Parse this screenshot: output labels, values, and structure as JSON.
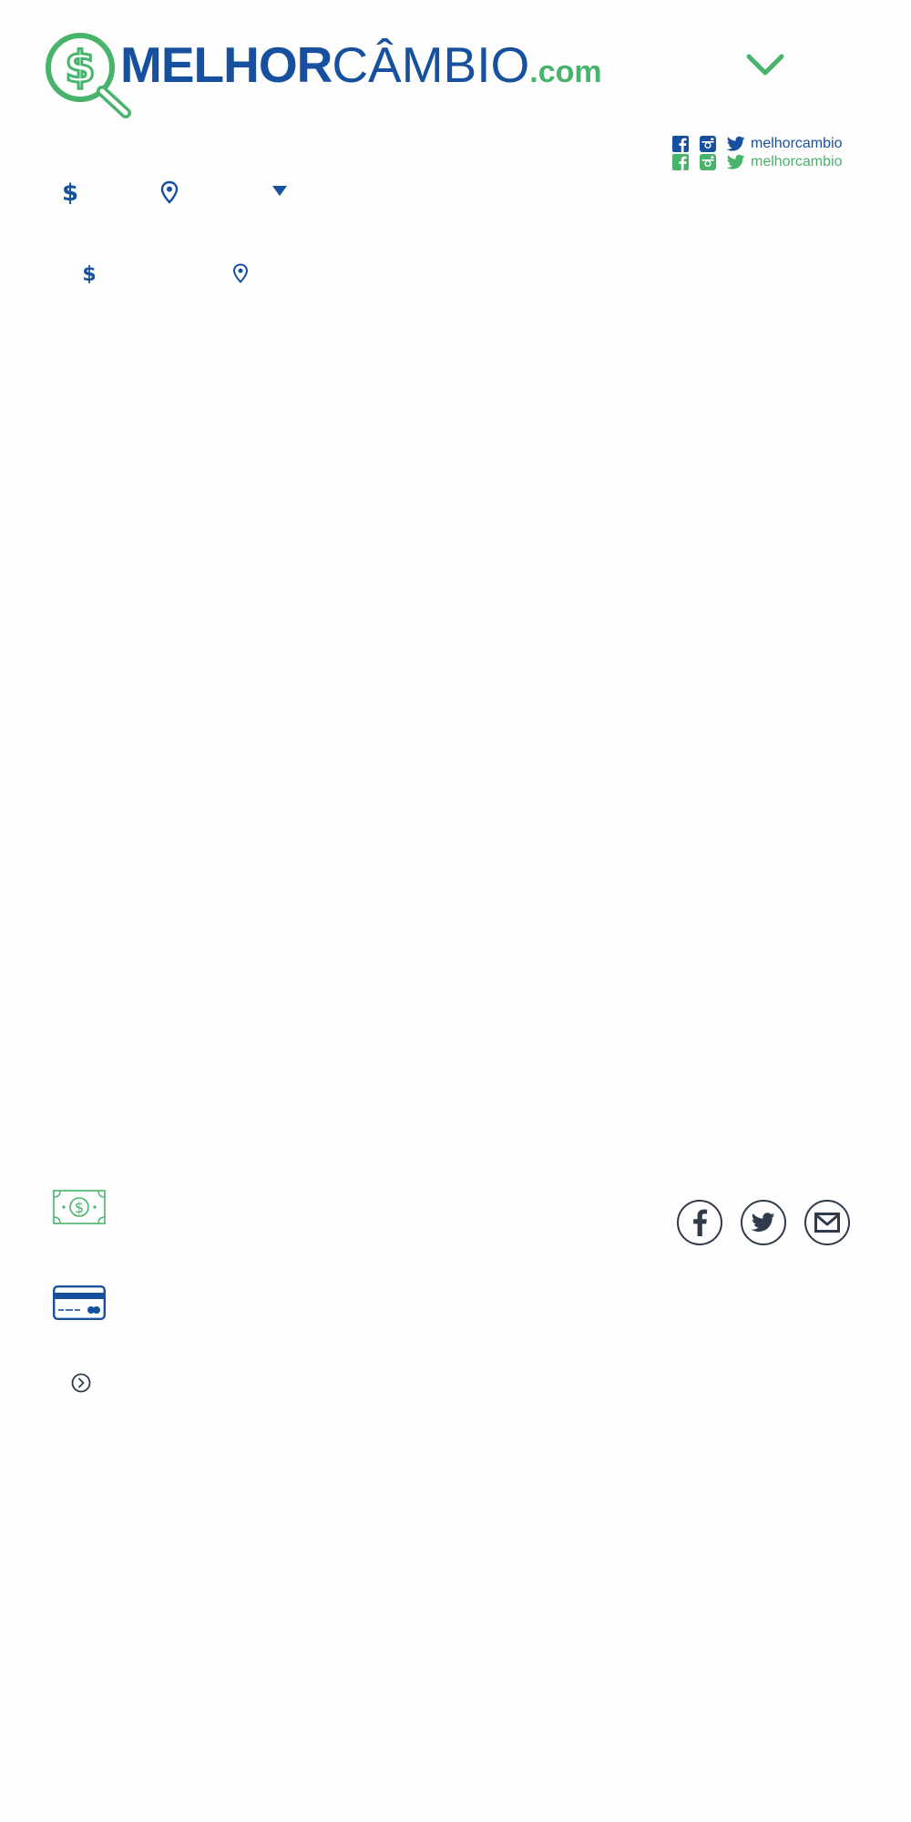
{
  "header": {
    "logo": {
      "word_bold": "MELHOR",
      "word_light": "CÂMBIO",
      "word_suffix": ".com"
    },
    "menu_icon": "chevron-down-icon"
  },
  "social": {
    "blue_row": {
      "handle": "melhorcambio",
      "icons": [
        "facebook-icon",
        "instagram-icon",
        "twitter-icon"
      ]
    },
    "green_row": {
      "handle": "melhorcambio",
      "icons": [
        "facebook-icon",
        "instagram-icon",
        "twitter-icon"
      ]
    }
  },
  "filters": {
    "icons": [
      "dollar-icon",
      "location-pin-icon",
      "caret-down-icon"
    ]
  },
  "payment_icons": [
    "cash-bill-icon",
    "credit-card-icon",
    "chevron-right-circle-icon"
  ],
  "share_icons": [
    "facebook-icon",
    "twitter-icon",
    "email-icon"
  ],
  "colors": {
    "brand_blue": "#16509e",
    "brand_green": "#47b36b",
    "icon_dark": "#2f3b4b",
    "background": "#fefefe"
  }
}
